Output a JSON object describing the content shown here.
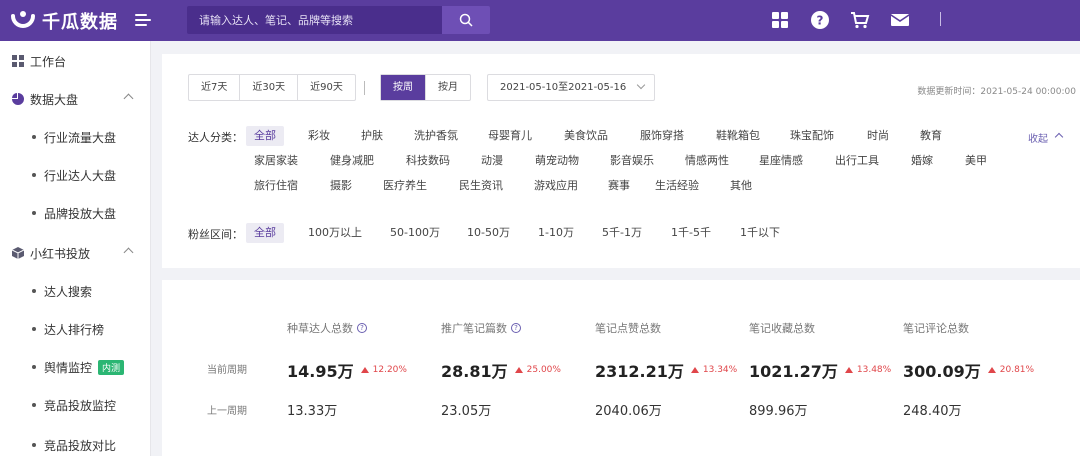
{
  "header": {
    "brand": "千瓜数据",
    "search_placeholder": "请输入达人、笔记、品牌等搜索"
  },
  "sidebar": {
    "workspace": "工作台",
    "data_dashboard": "数据大盘",
    "data_items": [
      "行业流量大盘",
      "行业达人大盘",
      "品牌投放大盘"
    ],
    "xhs": "小红书投放",
    "xhs_items": [
      "达人搜索",
      "达人排行榜",
      "舆情监控",
      "竞品投放监控",
      "竞品投放对比"
    ],
    "internal_badge": "内测"
  },
  "filters": {
    "ranges": [
      "近7天",
      "近30天",
      "近90天"
    ],
    "period_modes": [
      "按周",
      "按月"
    ],
    "active_mode": "按周",
    "date_range": "2021-05-10至2021-05-16",
    "update_time": "数据更新时间：2021-05-24 00:00:00",
    "category_label": "达人分类：",
    "categories_row1": [
      "全部",
      "彩妆",
      "护肤",
      "洗护香氛",
      "母婴育儿",
      "美食饮品",
      "服饰穿搭",
      "鞋靴箱包",
      "珠宝配饰",
      "时尚",
      "教育"
    ],
    "categories_row2": [
      "家居家装",
      "健身减肥",
      "科技数码",
      "动漫",
      "萌宠动物",
      "影音娱乐",
      "情感两性",
      "星座情感",
      "出行工具",
      "婚嫁",
      "美甲"
    ],
    "categories_row3": [
      "旅行住宿",
      "摄影",
      "医疗养生",
      "民生资讯",
      "游戏应用",
      "赛事",
      "生活经验",
      "其他"
    ],
    "collapse": "收起",
    "fans_label": "粉丝区间：",
    "fans_ranges": [
      "全部",
      "100万以上",
      "50-100万",
      "10-50万",
      "1-10万",
      "5千-1万",
      "1千-5千",
      "1千以下"
    ]
  },
  "stats": {
    "current_label": "当前周期",
    "previous_label": "上一周期",
    "metrics": [
      {
        "title": "种草达人总数",
        "current": "14.95万",
        "change": "12.20%",
        "previous": "13.33万"
      },
      {
        "title": "推广笔记篇数",
        "current": "28.81万",
        "change": "25.00%",
        "previous": "23.05万"
      },
      {
        "title": "笔记点赞总数",
        "current": "2312.21万",
        "change": "13.34%",
        "previous": "2040.06万"
      },
      {
        "title": "笔记收藏总数",
        "current": "1021.27万",
        "change": "13.48%",
        "previous": "899.96万"
      },
      {
        "title": "笔记评论总数",
        "current": "300.09万",
        "change": "20.81%",
        "previous": "248.40万"
      }
    ]
  }
}
